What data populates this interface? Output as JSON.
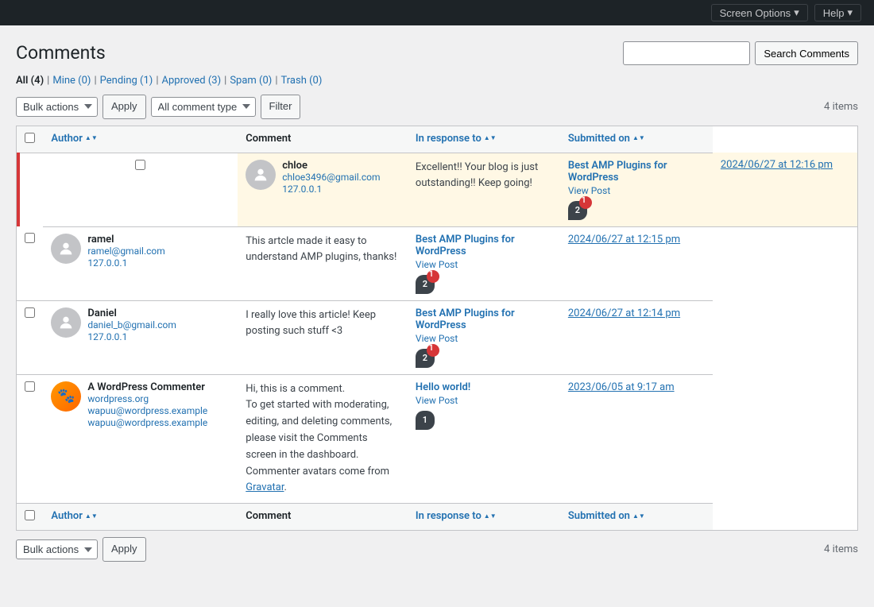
{
  "topbar": {
    "screen_options_label": "Screen Options",
    "help_label": "Help"
  },
  "page": {
    "title": "Comments"
  },
  "filters": {
    "all_label": "All (4)",
    "mine_label": "Mine (0)",
    "pending_label": "Pending (1)",
    "approved_label": "Approved (3)",
    "spam_label": "Spam (0)",
    "trash_label": "Trash (0)",
    "bulk_actions_label": "Bulk actions",
    "bulk_apply_label": "Apply",
    "comment_type_label": "All comment type",
    "filter_label": "Filter",
    "items_count": "4 items"
  },
  "search": {
    "placeholder": "",
    "button_label": "Search Comments"
  },
  "table": {
    "col_author": "Author",
    "col_comment": "Comment",
    "col_response": "In response to",
    "col_submitted": "Submitted on"
  },
  "comments": [
    {
      "id": 1,
      "unapproved": true,
      "author_name": "chloe",
      "author_email": "chloe3496@gmail.com",
      "author_ip": "127.0.0.1",
      "author_avatar": "gray",
      "comment": "Excellent!! Your blog is just outstanding!! Keep going!",
      "response_title": "Best AMP Plugins for WordPress",
      "response_view": "View Post",
      "bubble_count": "2",
      "bubble_red_count": "1",
      "submitted": "2024/06/27 at 12:16 pm"
    },
    {
      "id": 2,
      "unapproved": false,
      "author_name": "ramel",
      "author_email": "ramel@gmail.com",
      "author_ip": "127.0.0.1",
      "author_avatar": "gray",
      "comment": "This artcle made it easy to understand AMP plugins, thanks!",
      "response_title": "Best AMP Plugins for WordPress",
      "response_view": "View Post",
      "bubble_count": "2",
      "bubble_red_count": "1",
      "submitted": "2024/06/27 at 12:15 pm"
    },
    {
      "id": 3,
      "unapproved": false,
      "author_name": "Daniel",
      "author_email": "daniel_b@gmail.com",
      "author_ip": "127.0.0.1",
      "author_avatar": "gray",
      "comment": "I really love this article! Keep posting such stuff <3",
      "response_title": "Best AMP Plugins for WordPress",
      "response_view": "View Post",
      "bubble_count": "2",
      "bubble_red_count": "1",
      "submitted": "2024/06/27 at 12:14 pm"
    },
    {
      "id": 4,
      "unapproved": false,
      "author_name": "A WordPress Commenter",
      "author_email": "wordpress.org",
      "author_ip_label": "wapuu@wordpress.example",
      "author_avatar": "wp",
      "comment_part1": "Hi, this is a comment.",
      "comment_part2": "To get started with moderating, editing, and deleting comments, please visit the Comments screen in the dashboard.",
      "comment_part3": "Commenter avatars come from",
      "comment_link_text": "Gravatar",
      "comment_link_url": "#",
      "comment_part4": ".",
      "response_title": "Hello world!",
      "response_view": "View Post",
      "bubble_count": "1",
      "bubble_red_count": null,
      "submitted": "2023/06/05 at 9:17 am"
    }
  ],
  "bottom": {
    "bulk_actions_label": "Bulk actions",
    "apply_label": "Apply",
    "items_count": "4 items"
  }
}
